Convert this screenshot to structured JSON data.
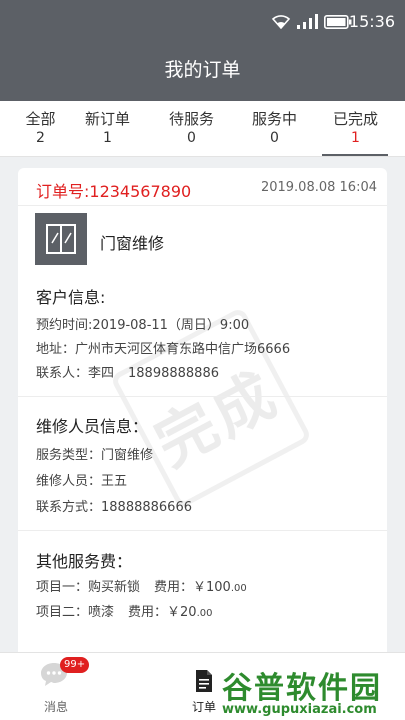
{
  "status_bar": {
    "time": "15:36"
  },
  "header": {
    "title": "我的订单"
  },
  "tabs": [
    {
      "label": "全部",
      "count": "2"
    },
    {
      "label": "新订单",
      "count": "1"
    },
    {
      "label": "待服务",
      "count": "0"
    },
    {
      "label": "服务中",
      "count": "0"
    },
    {
      "label": "已完成",
      "count": "1"
    }
  ],
  "order": {
    "number": "订单号:1234567890",
    "time": "2019.08.08  16:04",
    "service_name": "门窗维修",
    "stamp_text": "完成",
    "customer": {
      "title": "客户信息:",
      "appointment": "预约时间:2019-08-11（周日）9:00",
      "address": "地址：广州市天河区体育东路中信广场6666",
      "contact_label": "联系人：李四",
      "contact_phone": "18898888886"
    },
    "worker": {
      "title": "维修人员信息：",
      "service_type": "服务类型：门窗维修",
      "worker_name": "维修人员：王五",
      "contact": "联系方式：18888886666"
    },
    "fees": {
      "title": "其他服务费：",
      "item1_name": "项目一：购买新锁",
      "item1_fee_label": "费用：￥100",
      "item1_fee_decimal": ".00",
      "item2_name": "项目二：喷漆",
      "item2_fee_label": "费用：￥20",
      "item2_fee_decimal": ".00"
    }
  },
  "bottom_nav": {
    "messages_label": "消息",
    "messages_badge": "99+",
    "orders_label": "订单"
  },
  "watermark": {
    "main": "谷普软件园",
    "url": "www.gupuxiazai.com"
  },
  "colors": {
    "header_bg": "#5c6066",
    "accent_red": "#e02020",
    "watermark_green": "#2e8b2e"
  }
}
